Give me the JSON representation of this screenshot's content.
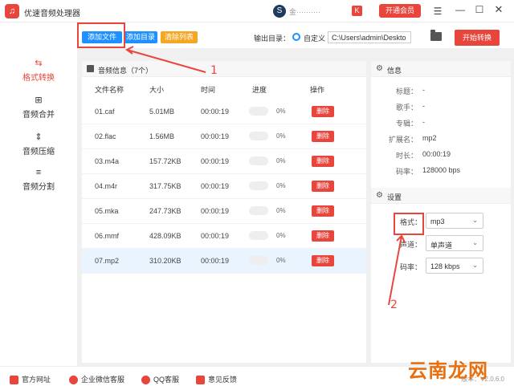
{
  "app": {
    "title": "优速音频处理器",
    "logo_glyph": "♫"
  },
  "titlebar": {
    "user_initial": "S",
    "user_name": "金··········",
    "k_badge": "K",
    "vip_label": "开通会员",
    "icons": [
      "menu-icon",
      "minimize-icon",
      "maximize-icon",
      "close-icon"
    ]
  },
  "toolbar": {
    "add_file": "添加文件",
    "add_dir": "添加目录",
    "clear_list": "清除列表",
    "output_label": "输出目录：",
    "radio_label": "自定义",
    "output_path": "C:\\Users\\admin\\Deskto",
    "start": "开始转换"
  },
  "sidebar": {
    "items": [
      {
        "label": "格式转换",
        "icon": "⇆",
        "active": true
      },
      {
        "label": "音频合并",
        "icon": "⊞",
        "active": false
      },
      {
        "label": "音频压缩",
        "icon": "⇕",
        "active": false
      },
      {
        "label": "音频分割",
        "icon": "≡",
        "active": false
      }
    ]
  },
  "file_panel": {
    "title": "音频信息（7个）",
    "columns": [
      "文件名称",
      "大小",
      "时间",
      "进度",
      "操作"
    ],
    "rows": [
      {
        "name": "01.caf",
        "size": "5.01MB",
        "time": "00:00:19",
        "progress": "0%",
        "action": "删除"
      },
      {
        "name": "02.flac",
        "size": "1.56MB",
        "time": "00:00:19",
        "progress": "0%",
        "action": "删除"
      },
      {
        "name": "03.m4a",
        "size": "157.72KB",
        "time": "00:00:19",
        "progress": "0%",
        "action": "删除"
      },
      {
        "name": "04.m4r",
        "size": "317.75KB",
        "time": "00:00:19",
        "progress": "0%",
        "action": "删除"
      },
      {
        "name": "05.mka",
        "size": "247.73KB",
        "time": "00:00:19",
        "progress": "0%",
        "action": "删除"
      },
      {
        "name": "06.mmf",
        "size": "428.09KB",
        "time": "00:00:19",
        "progress": "0%",
        "action": "删除"
      },
      {
        "name": "07.mp2",
        "size": "310.20KB",
        "time": "00:00:19",
        "progress": "0%",
        "action": "删除"
      }
    ]
  },
  "info_panel": {
    "title": "信息",
    "fields": [
      {
        "key": "标题：",
        "value": "-"
      },
      {
        "key": "歌手：",
        "value": "-"
      },
      {
        "key": "专辑：",
        "value": "-"
      },
      {
        "key": "扩展名：",
        "value": "mp2"
      },
      {
        "key": "时长：",
        "value": "00:00:19"
      },
      {
        "key": "码率：",
        "value": "128000 bps"
      }
    ]
  },
  "settings_panel": {
    "title": "设置",
    "format_label": "格式：",
    "format_value": "mp3",
    "channel_label": "声道：",
    "channel_value": "单声道",
    "bitrate_label": "码率：",
    "bitrate_value": "128 kbps"
  },
  "footer": {
    "official_site": "官方网址",
    "wechat_support": "企业微信客服",
    "qq_support": "QQ客服",
    "feedback": "意见反馈",
    "version": "版本：V2.0.6.0"
  },
  "annotations": {
    "num1": "1",
    "num2": "2"
  },
  "watermark": "云南龙网",
  "colors": {
    "accent": "#e8453c",
    "blue": "#1e90ff",
    "orange": "#f5a623"
  }
}
